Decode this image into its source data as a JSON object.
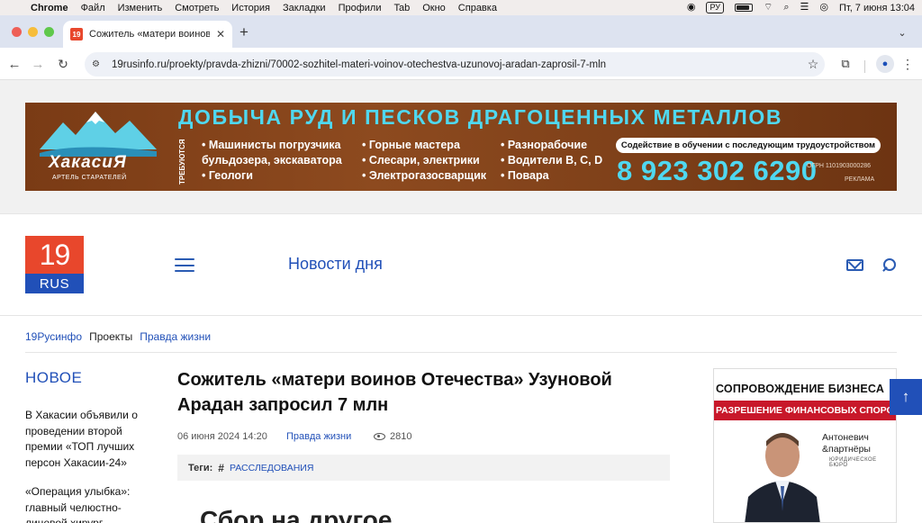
{
  "menubar": {
    "app": "Chrome",
    "items": [
      "Файл",
      "Изменить",
      "Смотреть",
      "История",
      "Закладки",
      "Профили",
      "Tab",
      "Окно",
      "Справка"
    ],
    "input_source": "РУ",
    "datetime": "Пт, 7 июня  13:04"
  },
  "browser": {
    "tab_title": "Сожитель «матери воинов Отечества» Узуновой Арадан запросил 7 млн",
    "favicon_text": "19",
    "url": "19rusinfo.ru/proekty/pravda-zhizni/70002-sozhitel-materi-voinov-otechestva-uzunovoj-aradan-zaprosil-7-mln"
  },
  "banner": {
    "headline": "ДОБЫЧА РУД И ПЕСКОВ ДРАГОЦЕННЫХ МЕТАЛЛОВ",
    "brand": "ХакасиЯ",
    "brand_sub": "АРТЕЛЬ СТАРАТЕЛЕЙ",
    "vertical_label": "ТРЕБУЮТСЯ",
    "col1": [
      "Машинисты погрузчика",
      "бульдозера, экскаватора",
      "Геологи"
    ],
    "col2": [
      "Горные мастера",
      "Слесари, электрики",
      "Электрогазосварщик"
    ],
    "col3": [
      "Разнорабочие",
      "Водители B, C, D",
      "Повара"
    ],
    "promo": "Содействие в обучении с последующим трудоустройством",
    "phone": "8 923 302 6290",
    "ogrn": "ОГРН 1101903000286",
    "ad_label": "РЕКЛАМА"
  },
  "header": {
    "logo_top": "19",
    "logo_bottom": "RUS",
    "news_of_day": "Новости дня"
  },
  "breadcrumb": {
    "home": "19Русинфо",
    "section": "Проекты",
    "current": "Правда жизни"
  },
  "sidebar": {
    "title": "НОВОЕ",
    "items": [
      "В Хакасии объявили о проведении второй премии «ТОП лучших персон Хакасии-24»",
      "«Операция улыбка»: главный челюстно-лицевой хирург"
    ]
  },
  "article": {
    "title": "Сожитель «матери воинов Отечества» Узуновой Арадан запросил 7 млн",
    "date": "06 июня 2024 14:20",
    "rubric": "Правда жизни",
    "views": "2810",
    "tags_label": "Теги:",
    "tag_hash": "#",
    "tag": "РАССЛЕДОВАНИЯ",
    "subheading": "Сбор на другое"
  },
  "side_ad": {
    "header": "СОПРОВОЖДЕНИЕ БИЗНЕСА",
    "band": "РАЗРЕШЕНИЕ ФИНАНСОВЫХ СПОРОВ",
    "firm_line1": "Антоневич",
    "firm_line2": "&партнёры",
    "firm_sub": "ЮРИДИЧЕСКОЕ БЮРО"
  },
  "colors": {
    "brand_red": "#e8472c",
    "brand_blue": "#2150b8",
    "banner_cyan": "#4fd8f0",
    "banner_brown": "#7a3b15",
    "ad_red": "#c8182a"
  }
}
